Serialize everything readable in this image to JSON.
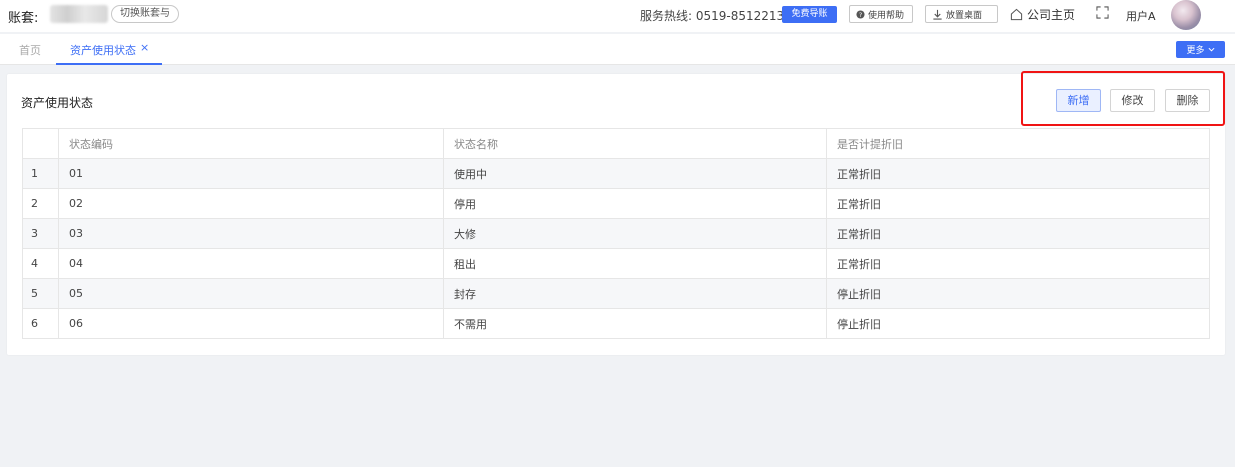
{
  "topbar": {
    "account_label": "账套:",
    "switch_label": "切换账套与",
    "hotline": "服务热线:  0519-85122137",
    "guide_label": "免费导账",
    "help_label": "使用帮助",
    "desktop_label": "放置桌面",
    "home_label": "公司主页",
    "user_name": "用户A",
    "accent_color": "#3d6ef5"
  },
  "tabs": {
    "home": "首页",
    "active": "资产使用状态",
    "close": "×",
    "more": "更多"
  },
  "card": {
    "title": "资产使用状态",
    "buttons": {
      "add": "新增",
      "edit": "修改",
      "delete": "删除"
    },
    "highlight_color": "#f01414"
  },
  "table": {
    "headers": [
      "",
      "状态编码",
      "状态名称",
      "是否计提折旧"
    ],
    "rows": [
      [
        "1",
        "01",
        "使用中",
        "正常折旧"
      ],
      [
        "2",
        "02",
        "停用",
        "正常折旧"
      ],
      [
        "3",
        "03",
        "大修",
        "正常折旧"
      ],
      [
        "4",
        "04",
        "租出",
        "正常折旧"
      ],
      [
        "5",
        "05",
        "封存",
        "停止折旧"
      ],
      [
        "6",
        "06",
        "不需用",
        "停止折旧"
      ]
    ]
  }
}
